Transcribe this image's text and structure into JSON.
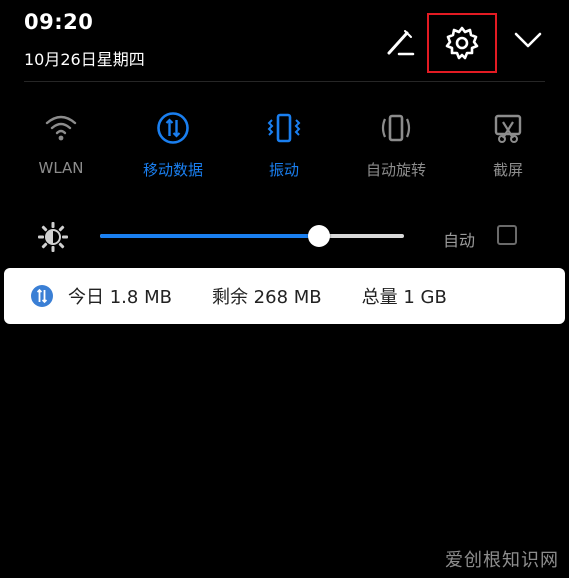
{
  "status": {
    "time": "09:20",
    "date": "10月26日星期四"
  },
  "header_icons": [
    "edit-icon",
    "settings-icon",
    "chevron-down-icon"
  ],
  "highlight_color": "#e31b23",
  "tiles": [
    {
      "label": "WLAN",
      "icon": "wifi-icon",
      "active": false
    },
    {
      "label": "移动数据",
      "icon": "mobile-data-icon",
      "active": true
    },
    {
      "label": "振动",
      "icon": "vibrate-icon",
      "active": true
    },
    {
      "label": "自动旋转",
      "icon": "auto-rotate-icon",
      "active": false
    },
    {
      "label": "截屏",
      "icon": "screenshot-icon",
      "active": false
    }
  ],
  "brightness": {
    "level": 0.72,
    "auto_label": "自动",
    "auto_checked": false
  },
  "data_usage": {
    "today": "今日 1.8 MB",
    "remaining": "剩余 268 MB",
    "total": "总量 1 GB"
  },
  "colors": {
    "accent": "#1a7ff0",
    "inactive": "#8c8c8c",
    "background": "#000000"
  },
  "watermark": "爱创根知识网"
}
